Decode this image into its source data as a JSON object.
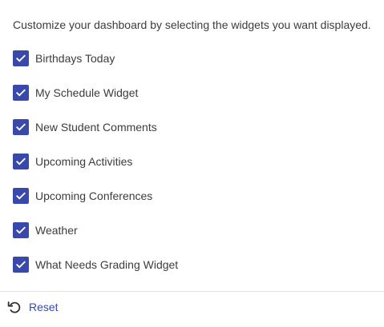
{
  "intro_text": "Customize your dashboard by selecting the widgets you want displayed.",
  "widgets": [
    {
      "label": "Birthdays Today",
      "checked": true
    },
    {
      "label": "My Schedule Widget",
      "checked": true
    },
    {
      "label": "New Student Comments",
      "checked": true
    },
    {
      "label": "Upcoming Activities",
      "checked": true
    },
    {
      "label": "Upcoming Conferences",
      "checked": true
    },
    {
      "label": "Weather",
      "checked": true
    },
    {
      "label": "What Needs Grading Widget",
      "checked": true
    }
  ],
  "footer": {
    "reset_label": "Reset",
    "reset_icon": "undo-icon"
  },
  "colors": {
    "accent": "#3949ab",
    "text": "#3c3c3c",
    "divider": "#e3e3e3"
  }
}
